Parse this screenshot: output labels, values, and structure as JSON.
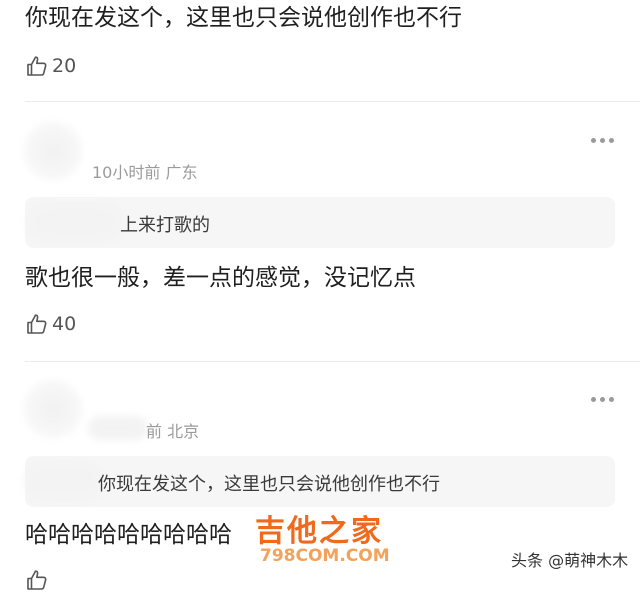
{
  "comments": [
    {
      "text": "你现在发这个，这里也只会说他创作也不行",
      "likes": "20"
    },
    {
      "meta": "10小时前 广东",
      "quote": "上来打歌的",
      "text": "歌也很一般，差一点的感觉，没记忆点",
      "likes": "40"
    },
    {
      "meta": "前 北京",
      "quote": "你现在发这个，这里也只会说他创作也不行",
      "text": "哈哈哈哈哈哈哈哈哈"
    }
  ],
  "watermark": {
    "main": "吉他之家",
    "sub": "798COM.COM",
    "source": "头条 @萌神木木"
  },
  "icons": {
    "like": "thumbs-up-icon",
    "more": "more-dots-icon"
  },
  "colors": {
    "watermark_orange": "#f06a1e",
    "meta_gray": "#9b9b9b",
    "quote_bg": "#f6f6f6"
  }
}
